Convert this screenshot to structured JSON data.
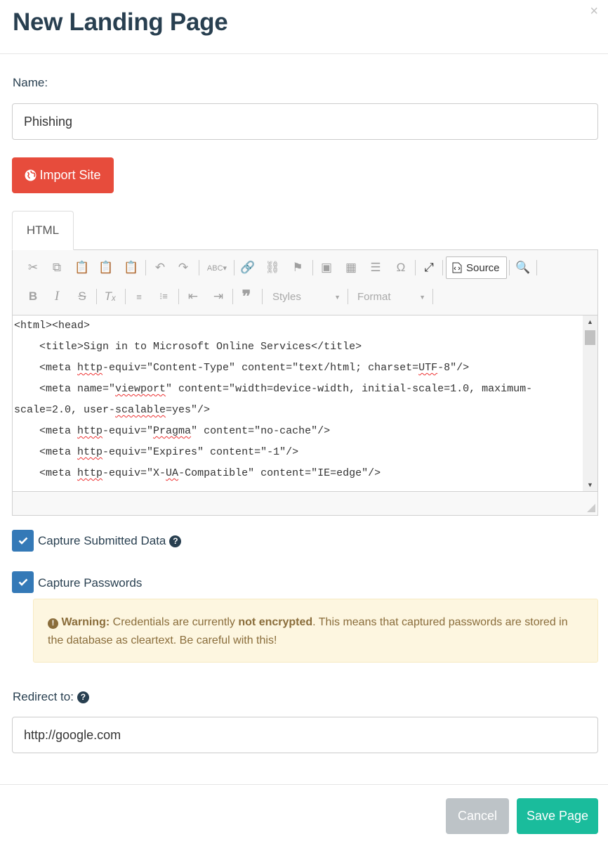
{
  "modal": {
    "title": "New Landing Page",
    "close_symbol": "×"
  },
  "name": {
    "label": "Name:",
    "value": "Phishing"
  },
  "import_button": {
    "label": "Import Site",
    "icon": "globe-icon"
  },
  "tabs": [
    {
      "label": "HTML"
    }
  ],
  "editor": {
    "toolbar": {
      "source_label": "Source",
      "styles_label": "Styles",
      "format_label": "Format"
    },
    "code_lines": [
      "<html><head>",
      "    <title>Sign in to Microsoft Online Services</title>",
      "    <meta http-equiv=\"Content-Type\" content=\"text/html; charset=UTF-8\"/>",
      "    <meta name=\"viewport\" content=\"width=device-width, initial-scale=1.0, maximum-",
      "scale=2.0, user-scalable=yes\"/>",
      "    <meta http-equiv=\"Pragma\" content=\"no-cache\"/>",
      "    <meta http-equiv=\"Expires\" content=\"-1\"/>",
      "    <meta http-equiv=\"X-UA-Compatible\" content=\"IE=edge\"/>"
    ]
  },
  "capture_data": {
    "label": "Capture Submitted Data",
    "checked": true
  },
  "capture_passwords": {
    "label": "Capture Passwords",
    "checked": true
  },
  "warning": {
    "prefix": "Warning:",
    "text_before": " Credentials are currently ",
    "bold": "not encrypted",
    "text_after": ". This means that captured passwords are stored in the database as cleartext. Be careful with this!"
  },
  "redirect": {
    "label": "Redirect to:",
    "value": "http://google.com"
  },
  "footer": {
    "cancel_label": "Cancel",
    "save_label": "Save Page"
  },
  "colors": {
    "primary": "#3479b7",
    "danger": "#e74c3c",
    "success": "#1abc9c",
    "muted": "#bdc3c7",
    "warning_bg": "#fdf6e0"
  }
}
